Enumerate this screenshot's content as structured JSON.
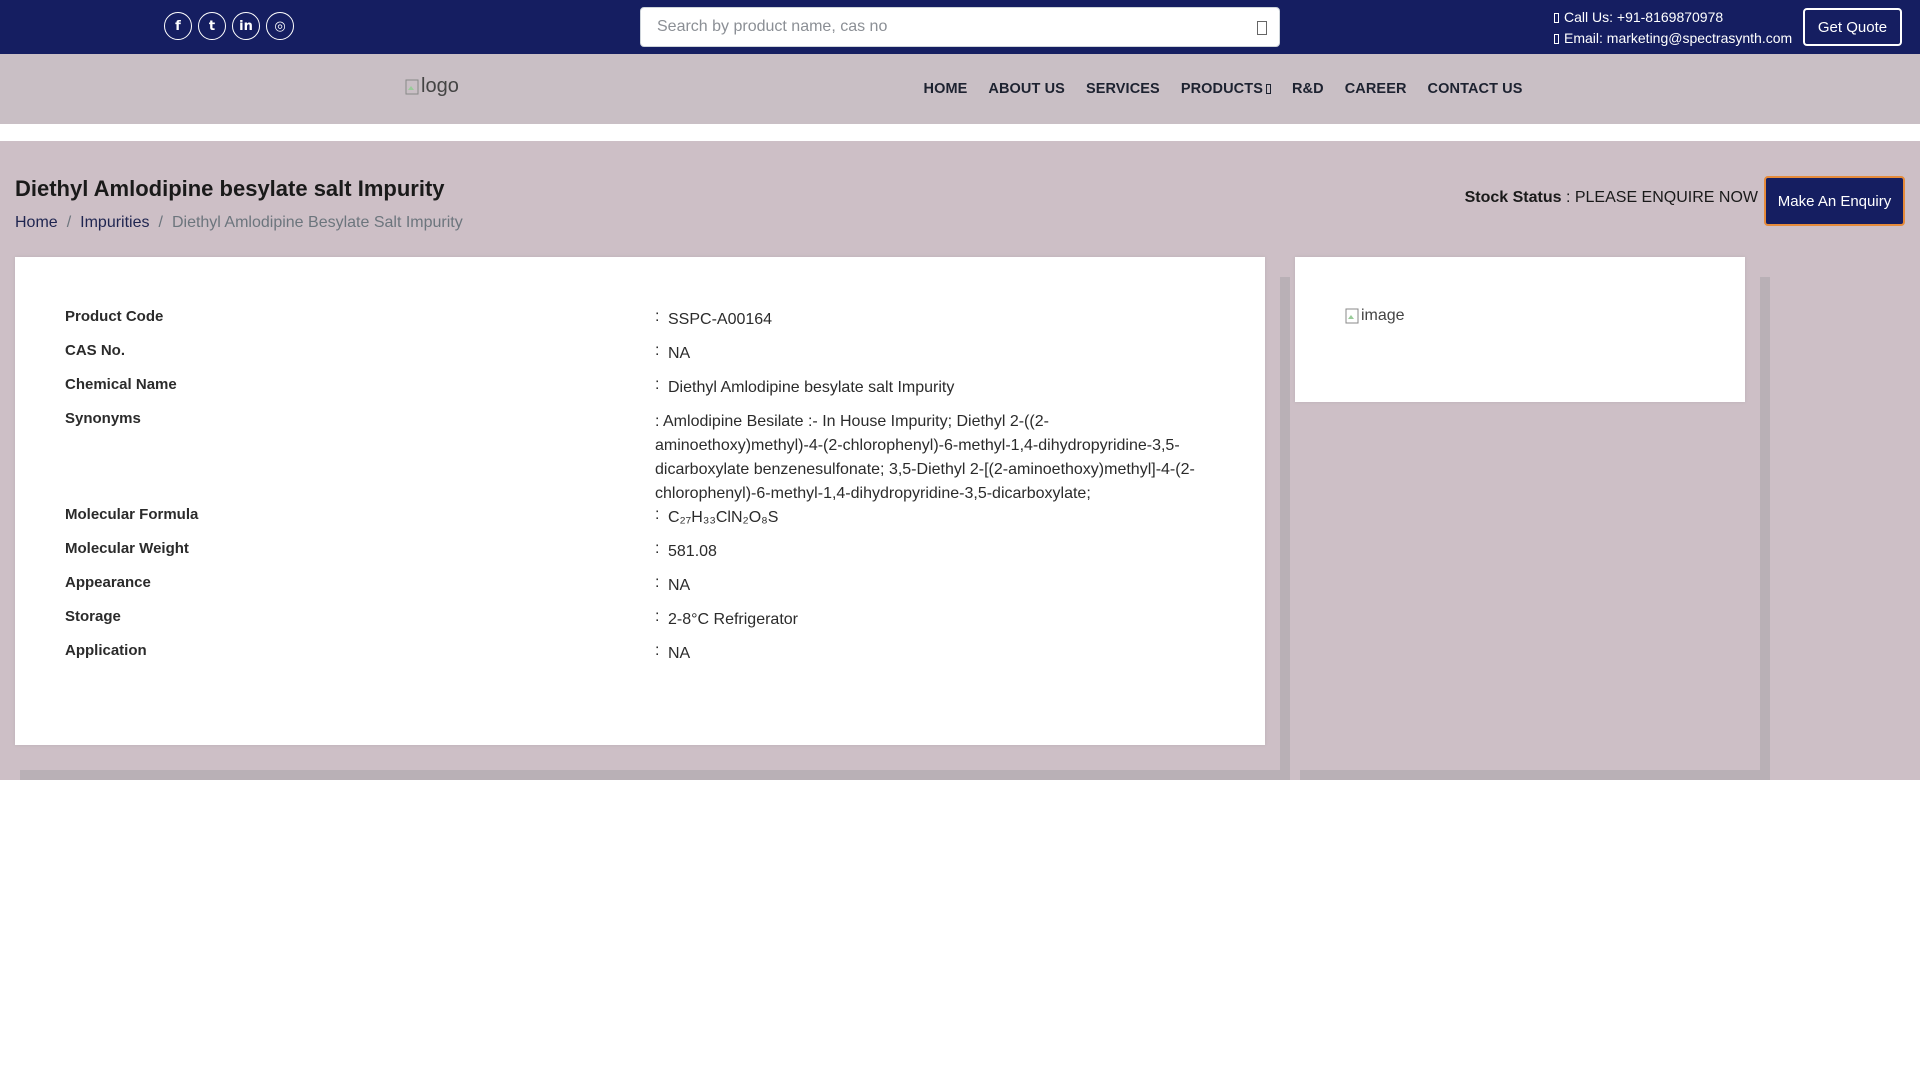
{
  "topbar": {
    "social": [
      {
        "name": "facebook-icon",
        "glyph": "f"
      },
      {
        "name": "twitter-icon",
        "glyph": "t"
      },
      {
        "name": "linkedin-icon",
        "glyph": "in"
      },
      {
        "name": "instagram-icon",
        "glyph": "◎"
      }
    ],
    "search_placeholder": "Search by product name, cas no",
    "search_value": "",
    "call_label": "Call Us: +91-8169870978",
    "email_label": "Email: marketing@spectrasynth.com",
    "quote_label": "Get Quote",
    "colors": {
      "bar": "#151e61",
      "text": "#ffffff"
    }
  },
  "nav": {
    "logo_alt": "logo",
    "links": [
      {
        "label": "HOME"
      },
      {
        "label": "ABOUT US"
      },
      {
        "label": "SERVICES"
      },
      {
        "label": "PRODUCTS",
        "dropdown": true
      },
      {
        "label": "R&D"
      },
      {
        "label": "CAREER"
      },
      {
        "label": "CONTACT US"
      }
    ],
    "background": "#c9bfc5"
  },
  "page": {
    "title": "Diethyl Amlodipine besylate salt Impurity",
    "breadcrumb": {
      "home": "Home",
      "sep1": "/",
      "category": "Impurities",
      "sep2": "/",
      "current": "Diethyl Amlodipine Besylate Salt Impurity"
    },
    "stock_label": "Stock Status",
    "stock_value": " : PLEASE ENQUIRE NOW",
    "enquiry_label": "Make An Enquiry",
    "accent_color": "#e58b3b"
  },
  "product": {
    "colon": ":",
    "code_label": "Product Code",
    "code_value": "SSPC-A00164",
    "cas_label": "CAS No.",
    "cas_value": "NA",
    "chem_label": "Chemical Name",
    "chem_value": "Diethyl Amlodipine besylate salt Impurity",
    "syn_label": "Synonyms",
    "syn_value": ":   Amlodipine Besilate :- In House Impurity; Diethyl 2-((2-aminoethoxy)methyl)-4-(2-chlorophenyl)-6-methyl-1,4-dihydropyridine-3,5-dicarboxylate benzenesulfonate; 3,5-Diethyl 2-[(2-aminoethoxy)methyl]-4-(2-chlorophenyl)-6-methyl-1,4-dihydropyridine-3,5-dicarboxylate;",
    "formula_label": "Molecular Formula",
    "formula_value": " C₂₇H₃₃ClN₂O₈S",
    "weight_label": "Molecular Weight",
    "weight_value": "581.08",
    "appearance_label": "Appearance",
    "appearance_value": "NA",
    "storage_label": "Storage",
    "storage_value": "2-8°C Refrigerator",
    "application_label": "Application",
    "application_value": "NA",
    "image_alt": "image"
  }
}
